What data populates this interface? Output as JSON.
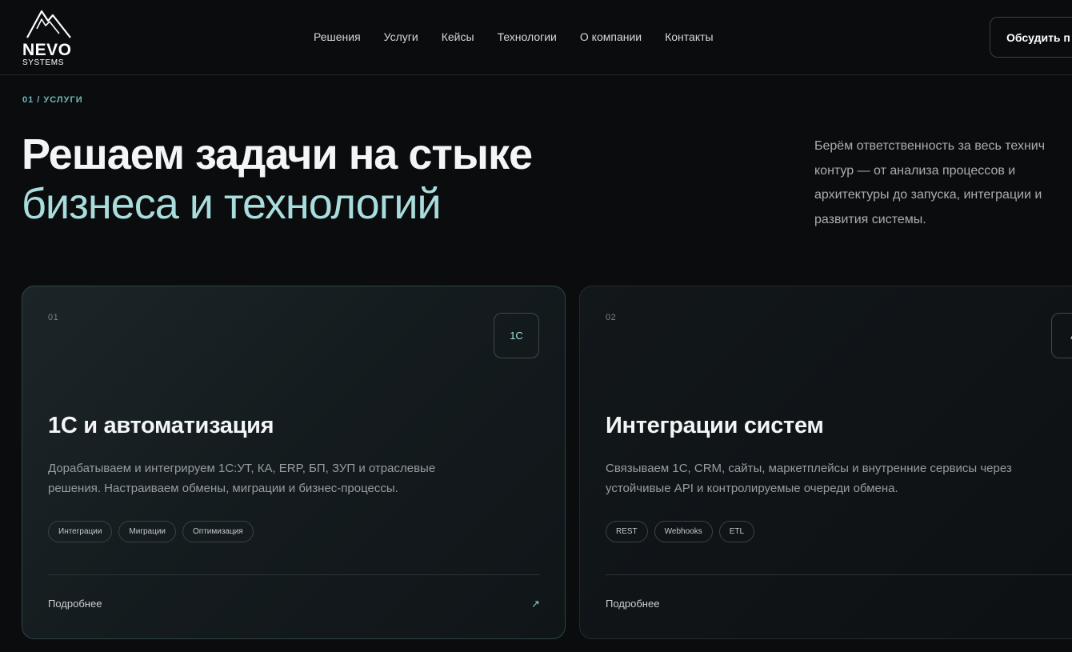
{
  "brand": {
    "name": "NEVO",
    "sub": "SYSTEMS"
  },
  "nav": {
    "items": [
      "Решения",
      "Услуги",
      "Кейсы",
      "Технологии",
      "О компании",
      "Контакты"
    ],
    "cta_label": "Обсудить п"
  },
  "section": {
    "eyebrow": "01 / УСЛУГИ",
    "headline_line1": "Решаем задачи на стыке",
    "headline_line2": "бизнеса и технологий",
    "intro_lines": [
      "Берём ответственность за весь технич",
      "контур — от анализа процессов и",
      "архитектуры до запуска, интеграции и",
      "развития системы."
    ]
  },
  "cards": [
    {
      "num": "01",
      "badge": "1С",
      "title": "1С и автоматизация",
      "desc_lines": [
        "Дорабатываем и интегрируем 1С:УТ, КА, ERP, БП, ЗУП и отраслевые",
        "решения. Настраиваем обмены, миграции и бизнес-процессы."
      ],
      "tags": [
        "Интеграции",
        "Миграции",
        "Оптимизация"
      ],
      "more": "Подробнее",
      "arrow": "↗"
    },
    {
      "num": "02",
      "badge": "A",
      "title": "Интеграции систем",
      "desc_lines": [
        "Связываем 1С, CRM, сайты, маркетплейсы и внутренние сервисы через",
        "устойчивые API и контролируемые очереди обмена."
      ],
      "tags": [
        "REST",
        "Webhooks",
        "ETL"
      ],
      "more": "Подробнее"
    }
  ],
  "colors": {
    "background": "#0b0c0e",
    "accent": "#a9dcdc",
    "eyebrow": "#6fb8ba"
  }
}
